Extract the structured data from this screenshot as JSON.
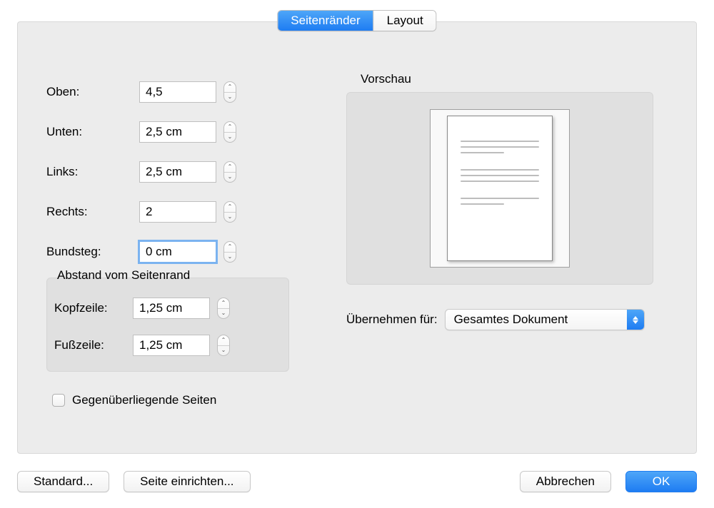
{
  "tabs": {
    "margins": "Seitenränder",
    "layout": "Layout"
  },
  "fields": {
    "top": {
      "label": "Oben:",
      "value": "4,5"
    },
    "bottom": {
      "label": "Unten:",
      "value": "2,5 cm"
    },
    "left": {
      "label": "Links:",
      "value": "2,5 cm"
    },
    "right": {
      "label": "Rechts:",
      "value": "2"
    },
    "gutter": {
      "label": "Bundsteg:",
      "value": "0 cm"
    }
  },
  "edge_group": {
    "title": "Abstand vom Seitenrand",
    "header": {
      "label": "Kopfzeile:",
      "value": "1,25 cm"
    },
    "footer": {
      "label": "Fußzeile:",
      "value": "1,25 cm"
    }
  },
  "mirror_pages": {
    "label": "Gegenüberliegende Seiten"
  },
  "preview_title": "Vorschau",
  "apply_to": {
    "label": "Übernehmen für:",
    "value": "Gesamtes Dokument"
  },
  "buttons": {
    "default": "Standard...",
    "page_setup": "Seite einrichten...",
    "cancel": "Abbrechen",
    "ok": "OK"
  }
}
